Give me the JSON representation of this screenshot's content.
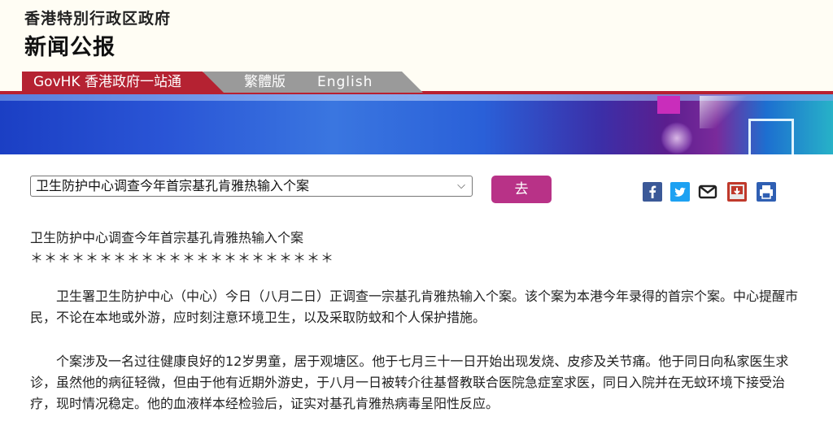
{
  "header": {
    "gov_title": "香港特別行政区政府",
    "press_title": "新闻公报"
  },
  "nav": {
    "govhk": "GovHK 香港政府一站通",
    "traditional": "繁體版",
    "english": "English"
  },
  "controls": {
    "selected_article": "卫生防护中心调查今年首宗基孔肯雅热输入个案",
    "go_label": "去"
  },
  "share": {
    "icons": [
      "facebook-icon",
      "twitter-icon",
      "email-icon",
      "bookmark-icon",
      "print-icon"
    ],
    "facebook_color": "#3b5998",
    "twitter_color": "#1da1f2",
    "email_color": "#222222",
    "bookmark_color": "#c0392b",
    "print_color": "#2f5fb3"
  },
  "article": {
    "title": "卫生防护中心调查今年首宗基孔肯雅热输入个案",
    "stars": "＊＊＊＊＊＊＊＊＊＊＊＊＊＊＊＊＊＊＊＊＊＊",
    "paragraphs": [
      "卫生署卫生防护中心（中心）今日（八月二日）正调查一宗基孔肯雅热输入个案。该个案为本港今年录得的首宗个案。中心提醒市民，不论在本地或外游，应时刻注意环境卫生，以及采取防蚊和个人保护措施。",
      "个案涉及一名过往健康良好的12岁男童，居于观塘区。他于七月三十一日开始出现发烧、皮疹及关节痛。他于同日向私家医生求诊，虽然他的病征轻微，但由于他有近期外游史，于八月一日被转介往基督教联合医院急症室求医，同日入院并在无蚊环境下接受治疗，现时情况稳定。他的血液样本经检验后，证实对基孔肯雅热病毒呈阳性反应。"
    ]
  }
}
